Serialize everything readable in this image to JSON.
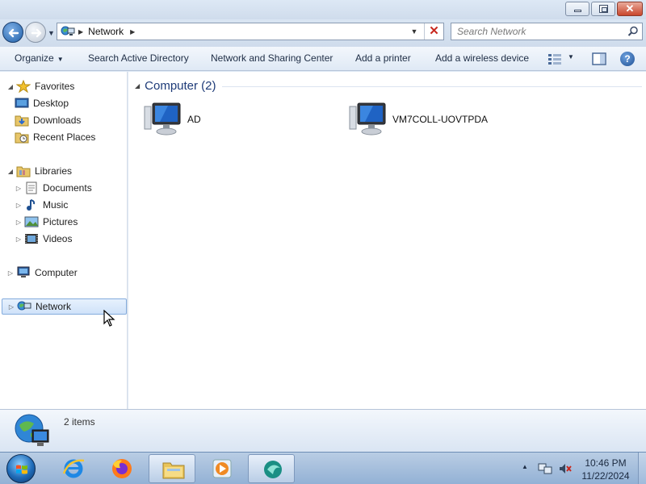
{
  "address": {
    "location": "Network"
  },
  "search": {
    "placeholder": "Search Network"
  },
  "toolbar": {
    "organize": "Organize",
    "search_ad": "Search Active Directory",
    "network_sharing": "Network and Sharing Center",
    "add_printer": "Add a printer",
    "add_wireless": "Add a wireless device"
  },
  "nav": {
    "favorites": "Favorites",
    "desktop": "Desktop",
    "downloads": "Downloads",
    "recent": "Recent Places",
    "libraries": "Libraries",
    "documents": "Documents",
    "music": "Music",
    "pictures": "Pictures",
    "videos": "Videos",
    "computer": "Computer",
    "network": "Network"
  },
  "content": {
    "group_label": "Computer (2)",
    "computers": [
      "AD",
      "VM7COLL-UOVTPDA"
    ]
  },
  "details": {
    "count": "2 items"
  },
  "taskbar": {
    "time": "10:46 PM",
    "date": "11/22/2024"
  },
  "icons": {
    "back": "back-arrow-icon",
    "forward": "forward-arrow-icon",
    "network": "network-icon",
    "search": "search-icon",
    "help": "help-icon",
    "computer": "computer-icon"
  }
}
